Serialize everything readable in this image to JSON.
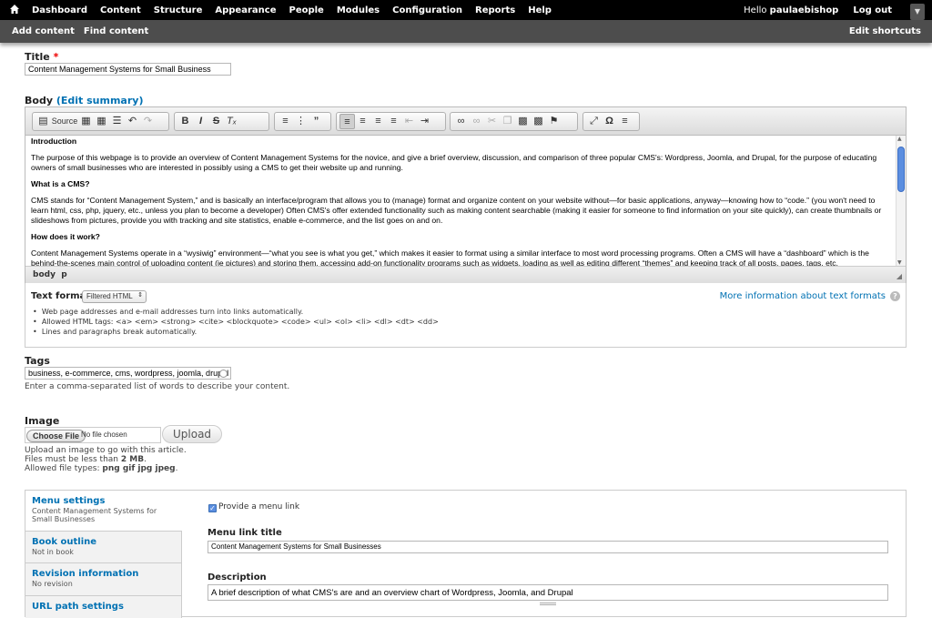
{
  "toolbar": {
    "home_icon": "home-icon",
    "menu": [
      "Dashboard",
      "Content",
      "Structure",
      "Appearance",
      "People",
      "Modules",
      "Configuration",
      "Reports",
      "Help"
    ],
    "hello_prefix": "Hello ",
    "username": "paulaebishop",
    "logout": "Log out",
    "shortcut_toggle_icon": "chevron-down-icon"
  },
  "shortcuts": {
    "items": [
      "Add content",
      "Find content"
    ],
    "edit": "Edit shortcuts"
  },
  "title_field": {
    "label": "Title",
    "required_mark": "*",
    "value": "Content Management Systems for Small Business"
  },
  "body_field": {
    "label": "Body",
    "summary_link": "(Edit summary)"
  },
  "editor": {
    "source_label": "Source",
    "content": {
      "h1": "Introduction",
      "p1": "The purpose of this webpage is to provide an overview of Content Management Systems for the novice, and give a brief overview, discussion, and comparison of three popular CMS's: Wordpress, Joomla, and Drupal, for the purpose of educating owners of small businesses who are interested in possibly using a CMS to get their website up and running.",
      "h2": "What is a CMS?",
      "p2": "CMS stands for “Content Management System,” and is basically an interface/program that allows you to (manage) format and organize content on your website without—for basic applications, anyway—knowing how to “code.” (you won't need to learn html, css, php, jquery, etc., unless you plan to become a developer) Often CMS's offer extended functionality such as making content searchable (making it easier for someone to find information on your site quickly), can create thumbnails or slideshows from pictures, provide you with tracking and site statistics, enable e-commerce, and the list goes on and on.",
      "h3": "How does it work?",
      "p3": "Content Management Systems operate in a “wysiwig” environment—“what you see is what you get,” which makes it easier to format using a similar interface to most word processing programs. Often a CMS will have a “dashboard” which is the behind-the-scenes main control of uploading content (ie pictures) and storing them, accessing add-on functionality programs such as widgets, loading as well as editing different “themes” and keeping track of all posts, pages, tags, etc."
    },
    "path": "body  p"
  },
  "text_format": {
    "label": "Text format",
    "selected": "Filtered HTML",
    "more_info": "More information about text formats",
    "tips": [
      "Web page addresses and e-mail addresses turn into links automatically.",
      "Allowed HTML tags: <a> <em> <strong> <cite> <blockquote> <code> <ul> <ol> <li> <dl> <dt> <dd>",
      "Lines and paragraphs break automatically."
    ]
  },
  "tags_field": {
    "label": "Tags",
    "value": "business, e-commerce, cms, wordpress, joomla, drupal",
    "description": "Enter a comma-separated list of words to describe your content."
  },
  "image_field": {
    "label": "Image",
    "choose_file": "Choose File",
    "no_file": "No file chosen",
    "upload": "Upload",
    "help1": "Upload an image to go with this article.",
    "help2_prefix": "Files must be less than ",
    "help2_value": "2 MB",
    "help2_suffix": ".",
    "help3_prefix": "Allowed file types: ",
    "help3_value": "png gif jpg jpeg",
    "help3_suffix": "."
  },
  "vertical_tabs": [
    {
      "title": "Menu settings",
      "summary": "Content Management Systems for Small Businesses"
    },
    {
      "title": "Book outline",
      "summary": "Not in book"
    },
    {
      "title": "Revision information",
      "summary": "No revision"
    },
    {
      "title": "URL path settings",
      "summary": ""
    }
  ],
  "menu_settings": {
    "provide_link_label": "Provide a menu link",
    "provide_link_checked": true,
    "link_title_label": "Menu link title",
    "link_title_value": "Content Management Systems for Small Businesses",
    "description_label": "Description",
    "description_value": "A brief description of what CMS's are and an overview chart of Wordpress, Joomla, and Drupal"
  },
  "colors": {
    "toolbar": "#000000",
    "shortcuts": "#4d4d4d",
    "link": "#0071b3",
    "required": "#ee0000"
  }
}
